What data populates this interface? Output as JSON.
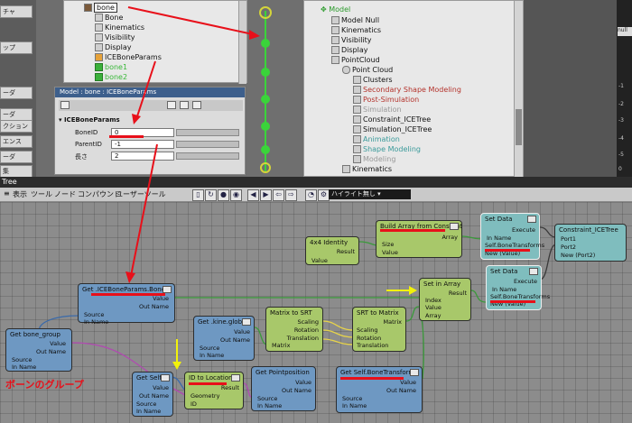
{
  "explorer1": {
    "rows": [
      "bone",
      "Bone",
      "Kinematics",
      "Visibility",
      "Display",
      "ICEBoneParams",
      "bone1",
      "bone2"
    ]
  },
  "left_toolbar": [
    "チャ",
    "ップ",
    "ーダ",
    "ーダ",
    "クション",
    "エンス",
    "ーダ",
    "集"
  ],
  "property_panel": {
    "title": "Model : bone : ICEBoneParams",
    "section": "ICEBoneParams",
    "fields": [
      {
        "label": "BoneID",
        "value": "0"
      },
      {
        "label": "ParentID",
        "value": "-1"
      },
      {
        "label": "長さ",
        "value": "2"
      }
    ]
  },
  "explorer2": {
    "rows": [
      "Model",
      "Model Null",
      "Kinematics",
      "Visibility",
      "Display",
      "PointCloud",
      "Point Cloud",
      "Clusters",
      "Secondary Shape Modeling",
      "Post-Simulation",
      "Simulation",
      "Constraint_ICETree",
      "Simulation_ICETree",
      "Animation",
      "Shape Modeling",
      "Modeling",
      "Kinematics"
    ]
  },
  "right_panel": {
    "labels": [
      "null",
      "-1",
      "-2",
      "-3",
      "-4",
      "-5",
      "0"
    ]
  },
  "ice": {
    "window_title": "Tree",
    "menu": [
      "表示",
      "ツール",
      "ノード",
      "コンパウンド",
      "ユーザーツール"
    ],
    "highlight": "ハイライト無し"
  },
  "nodes": {
    "identity": {
      "title": "4x4 Identity",
      "result": "Result",
      "value": "Value"
    },
    "build_array": {
      "title": "Build Array from Constant",
      "array": "Array",
      "size": "Size",
      "value": "Value"
    },
    "set_data1": {
      "title": "Set Data",
      "execute": "Execute",
      "in_name": "In Name",
      "ref": "Self.BoneTransforms",
      "new": "New (Value)"
    },
    "set_data2": {
      "title": "Set Data",
      "execute": "Execute",
      "in_name": "In Name",
      "ref": "Self.BoneTransforms",
      "new": "New (Value)"
    },
    "constraint": {
      "title": "Constraint_ICETree",
      "port1": "Port1",
      "port2": "Port2",
      "new": "New (Port2)"
    },
    "get_boneid": {
      "title": "Get .ICEBoneParams.BoneID",
      "value": "Value",
      "out_name": "Out Name",
      "source": "Source",
      "in_name": "In Name"
    },
    "set_in_array": {
      "title": "Set in Array",
      "result": "Result",
      "index": "Index",
      "value": "Value",
      "array": "Array"
    },
    "get_kine": {
      "title": "Get .kine.global",
      "value": "Value",
      "out_name": "Out Name",
      "source": "Source",
      "in_name": "In Name"
    },
    "matrix_srt": {
      "title": "Matrix to SRT",
      "scaling": "Scaling",
      "rotation": "Rotation",
      "translation": "Translation",
      "matrix": "Matrix"
    },
    "srt_matrix": {
      "title": "SRT to Matrix",
      "matrix": "Matrix",
      "scaling": "Scaling",
      "rotation": "Rotation",
      "translation": "Translation"
    },
    "get_bone_group": {
      "title": "Get bone_group",
      "value": "Value",
      "out_name": "Out Name",
      "source": "Source",
      "in_name": "In Name"
    },
    "get_self": {
      "title": "Get Self",
      "value": "Value",
      "out_name": "Out Name",
      "source": "Source",
      "in_name": "In Name"
    },
    "id_to_location": {
      "title": "ID to Location",
      "result": "Result",
      "geometry": "Geometry",
      "id": "ID"
    },
    "get_pointpos": {
      "title": "Get Pointposition",
      "value": "Value",
      "out_name": "Out Name",
      "source": "Source",
      "in_name": "In Name"
    },
    "get_bonetransforms": {
      "title": "Get Self.BoneTransforms",
      "value": "Value",
      "out_name": "Out Name",
      "source": "Source",
      "in_name": "In Name"
    }
  },
  "annotation": "ボーンのグループ",
  "colors": {
    "annotation_red": "#e8101a",
    "node_blue": "#6e98c2",
    "node_green": "#a8c86a",
    "node_teal": "#7fbdbe",
    "yellow_arrow": "#f2f20a"
  }
}
